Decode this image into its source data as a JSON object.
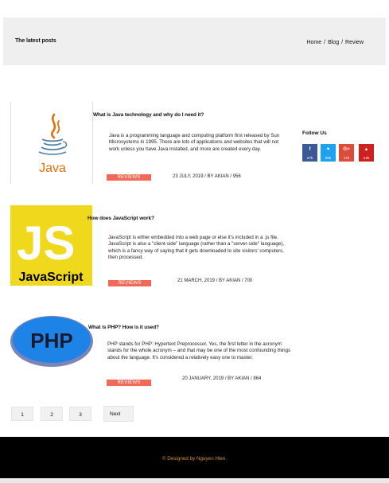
{
  "header": {
    "title": "The latest posts",
    "breadcrumb": [
      "Home",
      "Blog",
      "Review"
    ],
    "separator": "/"
  },
  "posts": [
    {
      "title": "What is Java technology and why do I need it?",
      "body": "Java is a programming language and computing platform first released by Sun Microsystems in 1995. There are lots of applications and websites that will not work unless you have Java installed, and more are created every day.",
      "badge": "REVIEWS",
      "meta": "23 JULY, 2019 / BY AKIAN  / 956",
      "image_text": "Java"
    },
    {
      "title": "How does JavaScript work?",
      "body": "JavaScript is either embedded into a web page or else it's included in a .js file. JavaScript is also a \"client-side\" language (rather than a \"server-side\" language), which is a fancy way of saying that it gets downloaded to site visitors' computers, then processed.",
      "badge": "REVIEWS",
      "meta": "21 MARCH, 2019 / BY AKIAN  / 700",
      "image_text_big": "JS",
      "image_text_small": "JavaScript"
    },
    {
      "title": "What is PHP? How is it used?",
      "body": "PHP stands for PHP: Hypertext Preprocessor. Yes, the first letter in the acronym stands for the whole acronym – and that may be one of the most confounding things about the language. It's considered a relatively easy one to master.",
      "badge": "REVIEWS",
      "meta": "20 JANUARY, 2019 / BY AKIAN /  864",
      "image_text": "PHP"
    }
  ],
  "follow": {
    "title": "Follow Us",
    "items": [
      {
        "icon": "facebook-icon",
        "glyph": "f",
        "count": "27k",
        "color": "#3b5998"
      },
      {
        "icon": "twitter-icon",
        "glyph": "♥",
        "count": "90k",
        "color": "#1da1f2"
      },
      {
        "icon": "google-plus-icon",
        "glyph": "G+",
        "count": "17k",
        "color": "#dd4b39"
      },
      {
        "icon": "youtube-icon",
        "glyph": "▲",
        "count": "22k",
        "color": "#cd201f"
      }
    ]
  },
  "pagination": {
    "pages": [
      "1",
      "2",
      "3"
    ],
    "next_label": "Next"
  },
  "footer": {
    "text": "© Designed by Nguyen Hien."
  },
  "colors": {
    "accent": "#f26a57",
    "header_bg": "#efefef",
    "footer_text": "#d9922a"
  }
}
